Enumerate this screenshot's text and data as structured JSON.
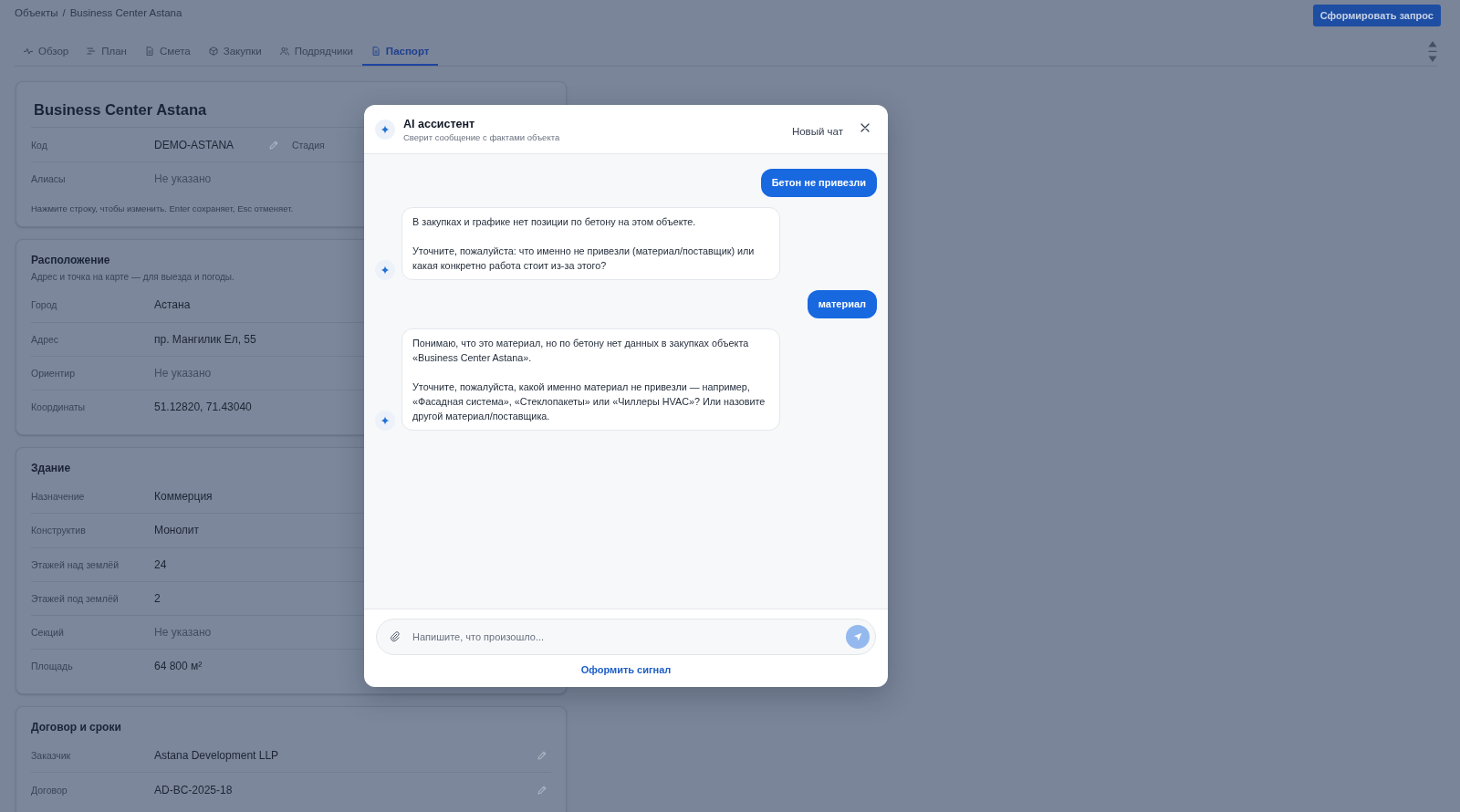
{
  "breadcrumb": {
    "items": [
      "Объекты",
      "Business Center Astana"
    ],
    "separator": "/"
  },
  "header_button": {
    "label": "Сформировать запрос"
  },
  "tabs": [
    {
      "label": "Обзор",
      "selected": false
    },
    {
      "label": "План",
      "selected": false
    },
    {
      "label": "Смета",
      "selected": false
    },
    {
      "label": "Закупки",
      "selected": false
    },
    {
      "label": "Подрядчики",
      "selected": false
    },
    {
      "label": "Паспорт",
      "selected": true
    }
  ],
  "sections": [
    {
      "kind": "object",
      "title": "Business Center Astana",
      "rows": [
        {
          "label": "Код",
          "value": "DEMO-ASTANA",
          "empty": false,
          "editable": true,
          "side_label": "Стадия"
        },
        {
          "label": "Алиасы",
          "value": "Не указано",
          "empty": true,
          "editable": false
        }
      ],
      "hint": "Нажмите строку, чтобы изменить. Enter сохраняет, Esc отменяет."
    },
    {
      "kind": "section",
      "title": "Расположение",
      "subtitle": "Адрес и точка на карте — для выезда и погоды.",
      "rows": [
        {
          "label": "Город",
          "value": "Астана",
          "empty": false,
          "editable": false
        },
        {
          "label": "Адрес",
          "value": "пр. Мангилик Ел, 55",
          "empty": false,
          "editable": false
        },
        {
          "label": "Ориентир",
          "value": "Не указано",
          "empty": true,
          "editable": false
        },
        {
          "label": "Координаты",
          "value": "51.12820, 71.43040",
          "empty": false,
          "editable": false
        }
      ]
    },
    {
      "kind": "section",
      "title": "Здание",
      "rows": [
        {
          "label": "Назначение",
          "value": "Коммерция",
          "empty": false,
          "editable": false
        },
        {
          "label": "Конструктив",
          "value": "Монолит",
          "empty": false,
          "editable": false
        },
        {
          "label": "Этажей над землёй",
          "value": "24",
          "empty": false,
          "editable": false
        },
        {
          "label": "Этажей под землёй",
          "value": "2",
          "empty": false,
          "editable": false
        },
        {
          "label": "Секций",
          "value": "Не указано",
          "empty": true,
          "editable": false
        },
        {
          "label": "Площадь",
          "value": "64 800 м²",
          "empty": false,
          "editable": false
        }
      ]
    },
    {
      "kind": "section",
      "title": "Договор и сроки",
      "rows": [
        {
          "label": "Заказчик",
          "value": "Astana Development LLP",
          "empty": false,
          "editable": true
        },
        {
          "label": "Договор",
          "value": "AD-BC-2025-18",
          "empty": false,
          "editable": true
        }
      ]
    }
  ],
  "assistant": {
    "title": "AI ассистент",
    "subtitle": "Сверит сообщение с фактами объекта",
    "new_chat": "Новый чат",
    "messages": [
      {
        "kind": "user",
        "text": "Бетон не привезли"
      },
      {
        "kind": "assistant",
        "paragraphs": [
          "В закупках и графике нет позиции по бетону на этом объекте.",
          "Уточните, пожалуйста: что именно не привезли (материал/поставщик) или какая конкретно работа стоит из-за этого?"
        ]
      },
      {
        "kind": "user",
        "text": "материал"
      },
      {
        "kind": "assistant",
        "paragraphs": [
          "Понимаю, что это материал, но по бетону нет данных в закупках объекта «Business Center Astana».",
          "Уточните, пожалуйста, какой именно материал не привезли — например, «Фасадная система», «Стеклопакеты» или «Чиллеры HVAC»? Или назовите другой материал/поставщика."
        ]
      }
    ],
    "input": {
      "placeholder": "Напишите, что произошло..."
    },
    "send_button": {
      "disabled": true
    },
    "signal_link": "Оформить сигнал"
  }
}
